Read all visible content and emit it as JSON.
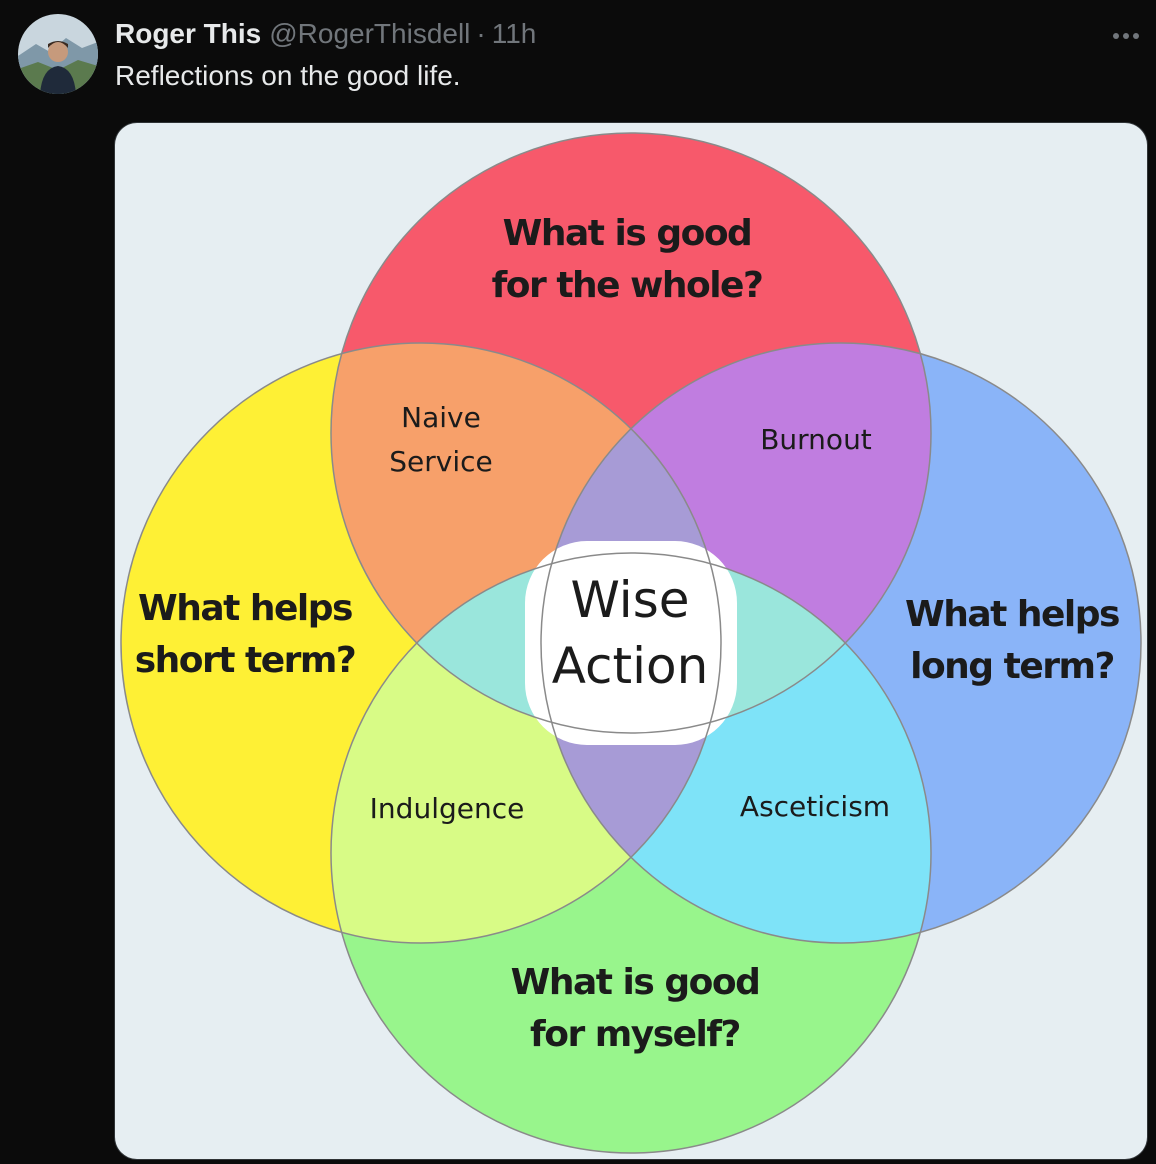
{
  "tweet": {
    "author_name": "Roger This",
    "handle": "@RogerThisdell",
    "separator": "·",
    "time": "11h",
    "text": "Reflections on the good life.",
    "more_icon": "more-horizontal-icon"
  },
  "diagram": {
    "circles": {
      "top": {
        "line1": "What is good",
        "line2": "for the whole?",
        "color": "#f7596b"
      },
      "left": {
        "line1": "What helps",
        "line2": "short term?",
        "color": "#fef035"
      },
      "right": {
        "line1": "What helps",
        "line2": "long term?",
        "color": "#8ab4f8"
      },
      "bottom": {
        "line1": "What is good",
        "line2": "for myself?",
        "color": "#98f58c"
      }
    },
    "overlaps": {
      "top_left": {
        "line1": "Naive",
        "line2": "Service",
        "color": "#f7a06a"
      },
      "top_right": {
        "line1": "Burnout",
        "color": "#c07de0"
      },
      "bottom_left": {
        "line1": "Indulgence",
        "color": "#d8fb86"
      },
      "bottom_right": {
        "line1": "Asceticism",
        "color": "#7ee3f8"
      }
    },
    "center": {
      "line1": "Wise",
      "line2": "Action",
      "color": "#ffffff"
    }
  }
}
